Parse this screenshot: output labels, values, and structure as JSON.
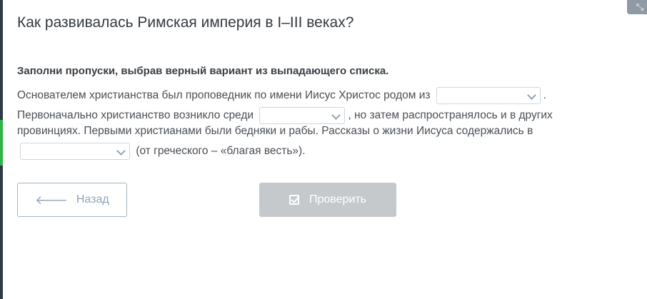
{
  "title": "Как развивалась Римская империя в I–III веках?",
  "instruction": "Заполни пропуски, выбрав верный вариант из выпадающего списка.",
  "lines": {
    "l1_text": "Основателем христианства был проповедник по имени Иисус Христос родом из",
    "l1_end": ".",
    "l2_text": "Первоначально христианство возникло среди",
    "l2_end": ", но затем распространялось и в других",
    "l3_text": "провинциях. Первыми христианами были бедняки и рабы. Рассказы о жизни Иисуса содержались в",
    "l4_end": "(от греческого – «благая весть»)."
  },
  "dropdowns": {
    "d1_value": "",
    "d2_value": "",
    "d3_value": ""
  },
  "buttons": {
    "back_label": "Назад",
    "back_icon": "arrow-left-icon",
    "check_label": "Проверить",
    "check_icon": "check-icon"
  },
  "colors": {
    "accent_green": "#2fb44a",
    "rail": "#2b3a45",
    "disabled_button": "#c6c9cc",
    "back_border": "#9fb3c5"
  }
}
